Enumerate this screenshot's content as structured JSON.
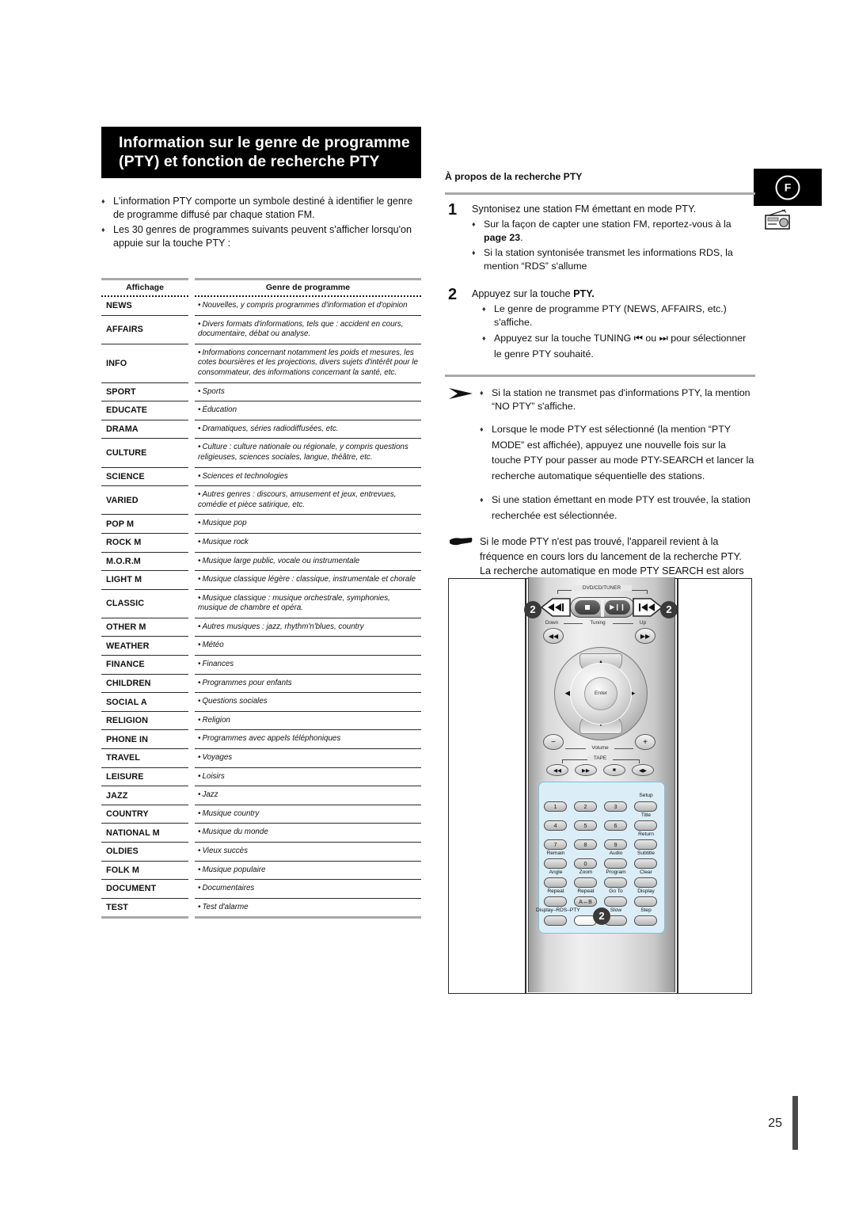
{
  "page": {
    "number": "25",
    "language_badge": "F",
    "radio_icon": "radio-icon"
  },
  "title": {
    "line1": "Information sur le genre de programme",
    "line2": "(PTY) et fonction de recherche PTY"
  },
  "intro": {
    "bullets": [
      "L'information PTY comporte un symbole destiné à identifier le genre de programme diffusé par chaque station FM.",
      "Les 30 genres de programmes suivants peuvent s'afficher lorsqu'on appuie sur la touche PTY :"
    ]
  },
  "table": {
    "headers": [
      "Affichage",
      "Genre de programme"
    ],
    "rows": [
      {
        "display": "NEWS",
        "genre": "Nouvelles, y compris programmes d'information et d'opinion"
      },
      {
        "display": "AFFAIRS",
        "genre": "Divers formats d'informations, tels que : accident en cours, documentaire, débat ou analyse."
      },
      {
        "display": "INFO",
        "genre": "Informations concernant notamment les poids et mesures, les cotes boursières et les projections, divers sujets d'intérêt pour le consommateur, des informations concernant la santé, etc."
      },
      {
        "display": "SPORT",
        "genre": "Sports"
      },
      {
        "display": "EDUCATE",
        "genre": "Éducation"
      },
      {
        "display": "DRAMA",
        "genre": "Dramatiques, séries radiodiffusées, etc."
      },
      {
        "display": "CULTURE",
        "genre": "Culture : culture nationale ou régionale, y compris questions religieuses, sciences sociales, langue, théâtre, etc."
      },
      {
        "display": "SCIENCE",
        "genre": "Sciences et technologies"
      },
      {
        "display": "VARIED",
        "genre": "Autres genres : discours, amusement et jeux, entrevues, comédie et pièce satirique, etc."
      },
      {
        "display": "POP M",
        "genre": "Musique pop"
      },
      {
        "display": "ROCK M",
        "genre": "Musique rock"
      },
      {
        "display": "M.O.R.M",
        "genre": "Musique large public, vocale ou instrumentale"
      },
      {
        "display": "LIGHT M",
        "genre": "Musique classique légère : classique, instrumentale et chorale"
      },
      {
        "display": "CLASSIC",
        "genre": "Musique classique : musique orchestrale, symphonies, musique de chambre et opéra."
      },
      {
        "display": "OTHER M",
        "genre": "Autres musiques : jazz, rhythm'n'blues, country"
      },
      {
        "display": "WEATHER",
        "genre": "Météo"
      },
      {
        "display": "FINANCE",
        "genre": "Finances"
      },
      {
        "display": "CHILDREN",
        "genre": "Programmes pour enfants"
      },
      {
        "display": "SOCIAL  A",
        "genre": "Questions sociales"
      },
      {
        "display": "RELIGION",
        "genre": "Religion"
      },
      {
        "display": "PHONE IN",
        "genre": "Programmes avec appels téléphoniques"
      },
      {
        "display": "TRAVEL",
        "genre": "Voyages"
      },
      {
        "display": "LEISURE",
        "genre": "Loisirs"
      },
      {
        "display": "JAZZ",
        "genre": "Jazz"
      },
      {
        "display": "COUNTRY",
        "genre": "Musique country"
      },
      {
        "display": "NATIONAL M",
        "genre": "Musique du monde"
      },
      {
        "display": "OLDIES",
        "genre": "Vieux succès"
      },
      {
        "display": "FOLK M",
        "genre": "Musique populaire"
      },
      {
        "display": "DOCUMENT",
        "genre": "Documentaires"
      },
      {
        "display": "TEST",
        "genre": "Test d'alarme"
      }
    ]
  },
  "search_section": {
    "heading": "À propos de la recherche PTY",
    "step1": {
      "number": "1",
      "lead": "Syntonisez une station FM émettant en mode PTY.",
      "subs": [
        "Sur la façon de capter une station FM, reportez-vous à la page 23.",
        "Si la station syntonisée transmet les informations RDS, la mention “RDS” s'allume"
      ],
      "sub1_bold": "page 23"
    },
    "step2": {
      "number": "2",
      "lead_prefix": "Appuyez sur la touche ",
      "lead_bold": "PTY.",
      "subs": [
        "Le genre de programme PTY (NEWS, AFFAIRS, etc.) s'affiche.",
        "Appuyez sur la touche TUNING ⏮ ou ⏭ pour sélectionner le genre PTY souhaité."
      ],
      "sub2_prefix": "Appuyez sur la touche TUNING ",
      "sub2_mid": " ou ",
      "sub2_suffix": " pour sélectionner le genre PTY souhaité."
    },
    "notes": [
      "Si la station ne transmet pas d'informations PTY, la mention “NO PTY” s'affiche.",
      "Lorsque le mode PTY est sélectionné (la mention “PTY MODE” est affichée), appuyez une nouvelle fois sur la touche PTY pour passer au mode PTY-SEARCH et lancer la recherche automatique séquentielle des stations.",
      "Si une station émettant en mode PTY est trouvée, la station recherchée est sélectionnée."
    ],
    "hand_note": "Si le mode PTY n'est pas trouvé, l'appareil revient à la fréquence en cours lors du lancement de la recherche PTY. La recherche automatique en mode PTY SEARCH est alors interrompue."
  },
  "remote": {
    "callouts": [
      "2",
      "2",
      "2"
    ],
    "labels": {
      "dvd_cd_tuner": "DVD/CD/TUNER",
      "tuning": "Tuning",
      "down": "Down",
      "up": "Up",
      "volume": "Volume",
      "tape": "TAPE",
      "enter": "Enter"
    },
    "numeric_keys": [
      "1",
      "2",
      "3",
      "4",
      "5",
      "6",
      "7",
      "8",
      "9",
      "0"
    ],
    "function_keys": [
      "Setup",
      "Title",
      "Return",
      "Subtitle",
      "Remain",
      "Audio",
      "Angle",
      "Zoom",
      "Program",
      "Clear",
      "Repeat",
      "Repeat",
      "A↔B",
      "Go To",
      "Display",
      "Display–RDS–PTY",
      "Slow",
      "Step"
    ]
  }
}
